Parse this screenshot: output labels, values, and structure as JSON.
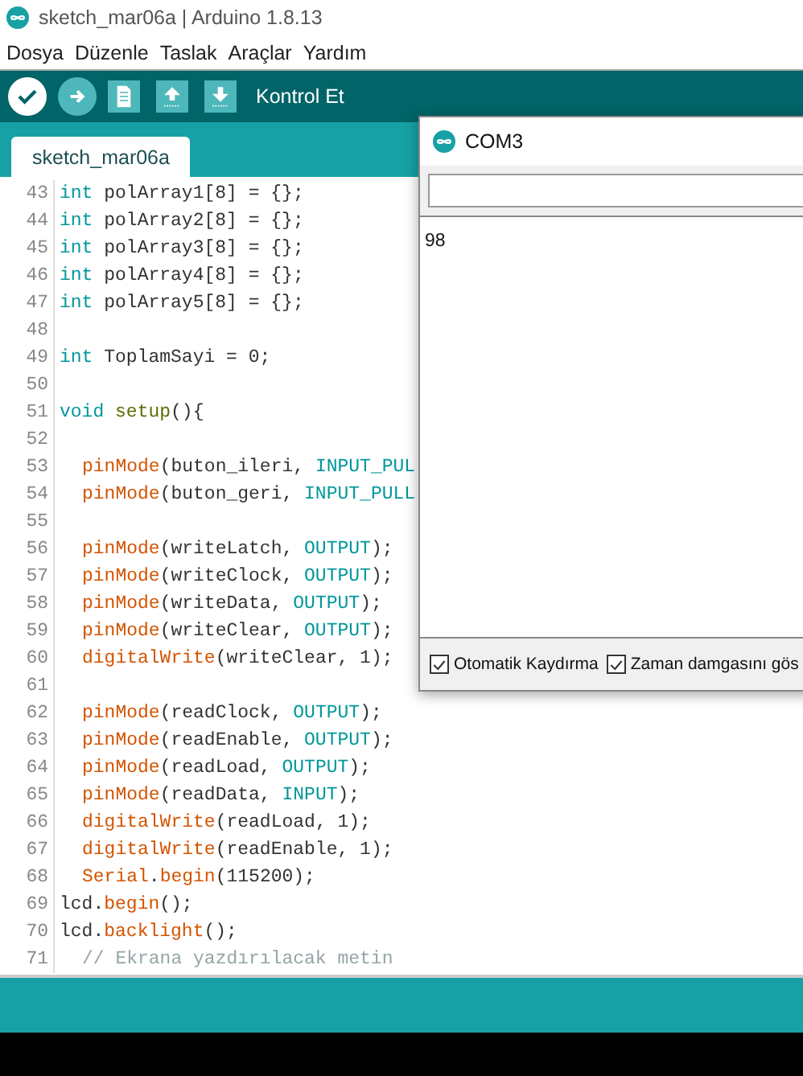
{
  "window": {
    "title": "sketch_mar06a | Arduino 1.8.13"
  },
  "menu": [
    "Dosya",
    "Düzenle",
    "Taslak",
    "Araçlar",
    "Yardım"
  ],
  "toolbar": {
    "buttons": [
      {
        "kind": "verify",
        "selected": true
      },
      {
        "kind": "upload",
        "selected": false
      },
      {
        "kind": "new",
        "selected": false
      },
      {
        "kind": "open",
        "selected": false
      },
      {
        "kind": "save",
        "selected": false
      }
    ],
    "label": "Kontrol Et"
  },
  "tabs": [
    {
      "label": "sketch_mar06a",
      "selected": true
    }
  ],
  "editor": {
    "lines": [
      {
        "number": "43",
        "tokens": [
          {
            "kind": "type",
            "text": "int"
          },
          {
            "kind": "plain",
            "text": " polArray1[8] = {};"
          }
        ]
      },
      {
        "number": "44",
        "tokens": [
          {
            "kind": "type",
            "text": "int"
          },
          {
            "kind": "plain",
            "text": " polArray2[8] = {};"
          }
        ]
      },
      {
        "number": "45",
        "tokens": [
          {
            "kind": "type",
            "text": "int"
          },
          {
            "kind": "plain",
            "text": " polArray3[8] = {};"
          }
        ]
      },
      {
        "number": "46",
        "tokens": [
          {
            "kind": "type",
            "text": "int"
          },
          {
            "kind": "plain",
            "text": " polArray4[8] = {};"
          }
        ]
      },
      {
        "number": "47",
        "tokens": [
          {
            "kind": "type",
            "text": "int"
          },
          {
            "kind": "plain",
            "text": " polArray5[8] = {};"
          }
        ]
      },
      {
        "number": "48"
      },
      {
        "number": "49",
        "tokens": [
          {
            "kind": "type",
            "text": "int"
          },
          {
            "kind": "plain",
            "text": " ToplamSayi = 0;"
          }
        ]
      },
      {
        "number": "50"
      },
      {
        "number": "51",
        "tokens": [
          {
            "kind": "type",
            "text": "void "
          },
          {
            "kind": "structure",
            "text": "setup"
          },
          {
            "kind": "plain",
            "text": "(){"
          }
        ]
      },
      {
        "number": "52"
      },
      {
        "number": "53",
        "indent": true,
        "tokens": [
          {
            "kind": "function",
            "text": "pinMode"
          },
          {
            "kind": "plain",
            "text": "(buton_ileri, "
          },
          {
            "kind": "constant",
            "text": "INPUT_PUL"
          }
        ]
      },
      {
        "number": "54",
        "indent": true,
        "tokens": [
          {
            "kind": "function",
            "text": "pinMode"
          },
          {
            "kind": "plain",
            "text": "(buton_geri, "
          },
          {
            "kind": "constant",
            "text": "INPUT_PULL"
          }
        ]
      },
      {
        "number": "55"
      },
      {
        "number": "56",
        "indent": true,
        "tokens": [
          {
            "kind": "function",
            "text": "pinMode"
          },
          {
            "kind": "plain",
            "text": "(writeLatch, "
          },
          {
            "kind": "constant",
            "text": "OUTPUT"
          },
          {
            "kind": "plain",
            "text": ");"
          }
        ]
      },
      {
        "number": "57",
        "indent": true,
        "tokens": [
          {
            "kind": "function",
            "text": "pinMode"
          },
          {
            "kind": "plain",
            "text": "(writeClock, "
          },
          {
            "kind": "constant",
            "text": "OUTPUT"
          },
          {
            "kind": "plain",
            "text": ");"
          }
        ]
      },
      {
        "number": "58",
        "indent": true,
        "tokens": [
          {
            "kind": "function",
            "text": "pinMode"
          },
          {
            "kind": "plain",
            "text": "(writeData, "
          },
          {
            "kind": "constant",
            "text": "OUTPUT"
          },
          {
            "kind": "plain",
            "text": ");"
          }
        ]
      },
      {
        "number": "59",
        "indent": true,
        "tokens": [
          {
            "kind": "function",
            "text": "pinMode"
          },
          {
            "kind": "plain",
            "text": "(writeClear, "
          },
          {
            "kind": "constant",
            "text": "OUTPUT"
          },
          {
            "kind": "plain",
            "text": ");"
          }
        ]
      },
      {
        "number": "60",
        "indent": true,
        "tokens": [
          {
            "kind": "function",
            "text": "digitalWrite"
          },
          {
            "kind": "plain",
            "text": "(writeClear, 1);"
          }
        ]
      },
      {
        "number": "61"
      },
      {
        "number": "62",
        "indent": true,
        "tokens": [
          {
            "kind": "function",
            "text": "pinMode"
          },
          {
            "kind": "plain",
            "text": "(readClock, "
          },
          {
            "kind": "constant",
            "text": "OUTPUT"
          },
          {
            "kind": "plain",
            "text": ");"
          }
        ]
      },
      {
        "number": "63",
        "indent": true,
        "tokens": [
          {
            "kind": "function",
            "text": "pinMode"
          },
          {
            "kind": "plain",
            "text": "(readEnable, "
          },
          {
            "kind": "constant",
            "text": "OUTPUT"
          },
          {
            "kind": "plain",
            "text": ");"
          }
        ]
      },
      {
        "number": "64",
        "indent": true,
        "tokens": [
          {
            "kind": "function",
            "text": "pinMode"
          },
          {
            "kind": "plain",
            "text": "(readLoad, "
          },
          {
            "kind": "constant",
            "text": "OUTPUT"
          },
          {
            "kind": "plain",
            "text": ");"
          }
        ]
      },
      {
        "number": "65",
        "indent": true,
        "tokens": [
          {
            "kind": "function",
            "text": "pinMode"
          },
          {
            "kind": "plain",
            "text": "(readData, "
          },
          {
            "kind": "constant",
            "text": "INPUT"
          },
          {
            "kind": "plain",
            "text": ");"
          }
        ]
      },
      {
        "number": "66",
        "indent": true,
        "tokens": [
          {
            "kind": "function",
            "text": "digitalWrite"
          },
          {
            "kind": "plain",
            "text": "(readLoad, 1);"
          }
        ]
      },
      {
        "number": "67",
        "indent": true,
        "tokens": [
          {
            "kind": "function",
            "text": "digitalWrite"
          },
          {
            "kind": "plain",
            "text": "(readEnable, 1);"
          }
        ]
      },
      {
        "number": "68",
        "indent": true,
        "tokens": [
          {
            "kind": "function",
            "text": "Serial"
          },
          {
            "kind": "plain",
            "text": "."
          },
          {
            "kind": "function",
            "text": "begin"
          },
          {
            "kind": "plain",
            "text": "(115200);"
          }
        ]
      },
      {
        "number": "69",
        "tokens": [
          {
            "kind": "plain",
            "text": "lcd."
          },
          {
            "kind": "function",
            "text": "begin"
          },
          {
            "kind": "plain",
            "text": "();"
          }
        ]
      },
      {
        "number": "70",
        "tokens": [
          {
            "kind": "plain",
            "text": "lcd."
          },
          {
            "kind": "function",
            "text": "backlight"
          },
          {
            "kind": "plain",
            "text": "();"
          }
        ]
      },
      {
        "number": "71",
        "indent": true,
        "tokens": [
          {
            "kind": "comment",
            "text": "// Ekrana yazdırılacak metin"
          }
        ]
      }
    ]
  },
  "serial_monitor": {
    "title": "COM3",
    "output": "98",
    "checkboxes": [
      {
        "label": "Otomatik Kaydırma",
        "checked": true
      },
      {
        "label": "Zaman damgasını gös",
        "checked": true
      }
    ]
  }
}
